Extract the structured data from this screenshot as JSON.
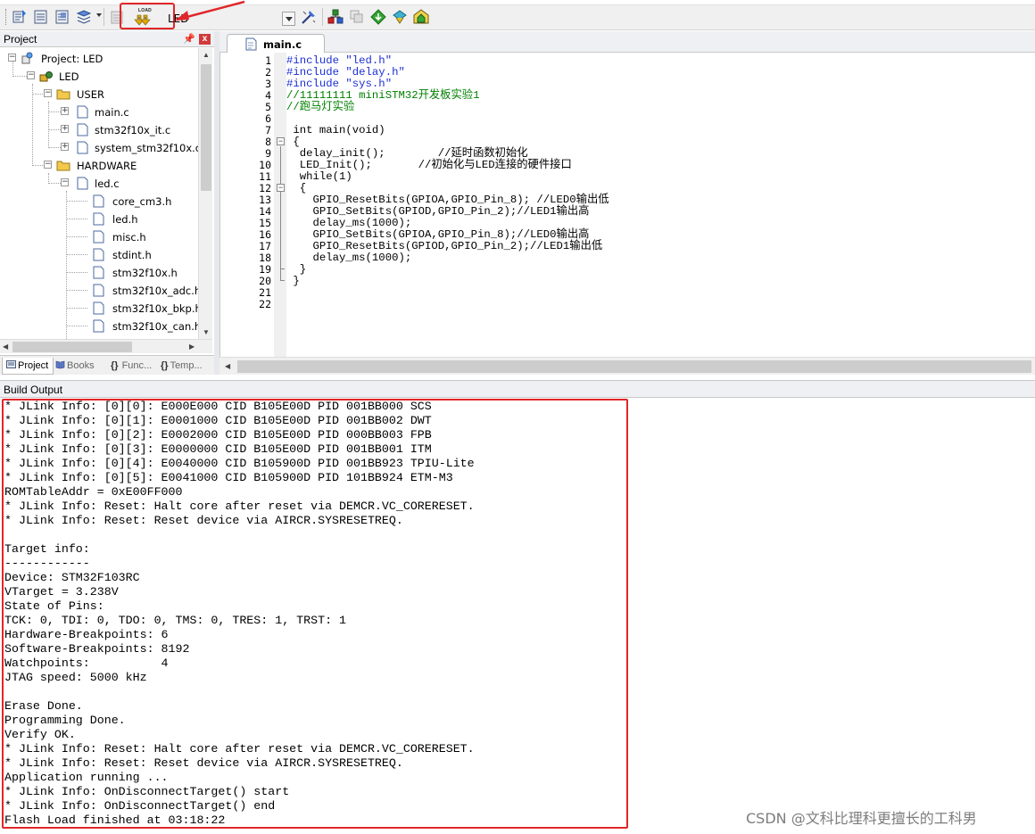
{
  "toolbar": {
    "load_label": "LOAD",
    "target": "LED"
  },
  "project_panel": {
    "title": "Project",
    "tree": [
      {
        "label": "Project: LED"
      },
      {
        "label": "LED"
      },
      {
        "label": "USER"
      },
      {
        "label": "main.c"
      },
      {
        "label": "stm32f10x_it.c"
      },
      {
        "label": "system_stm32f10x.c"
      },
      {
        "label": "HARDWARE"
      },
      {
        "label": "led.c"
      },
      {
        "label": "core_cm3.h"
      },
      {
        "label": "led.h"
      },
      {
        "label": "misc.h"
      },
      {
        "label": "stdint.h"
      },
      {
        "label": "stm32f10x.h"
      },
      {
        "label": "stm32f10x_adc.h"
      },
      {
        "label": "stm32f10x_bkp.h"
      },
      {
        "label": "stm32f10x_can.h"
      }
    ],
    "tabs": [
      "Project",
      "Books",
      "Func...",
      "Temp..."
    ]
  },
  "editor": {
    "tab": "main.c",
    "lines": [
      {
        "n": "1",
        "t": "#include \"led.h\""
      },
      {
        "n": "2",
        "t": "#include \"delay.h\""
      },
      {
        "n": "3",
        "t": "#include \"sys.h\""
      },
      {
        "n": "4",
        "t": "//11111111 miniSTM32开发板实验1"
      },
      {
        "n": "5",
        "t": "//跑马灯实验"
      },
      {
        "n": "6",
        "t": ""
      },
      {
        "n": "7",
        "t": " int main(void)"
      },
      {
        "n": "8",
        "t": " {"
      },
      {
        "n": "9",
        "t": "  delay_init();        //延时函数初始化"
      },
      {
        "n": "10",
        "t": "  LED_Init();       //初始化与LED连接的硬件接口"
      },
      {
        "n": "11",
        "t": "  while(1)"
      },
      {
        "n": "12",
        "t": "  {"
      },
      {
        "n": "13",
        "t": "    GPIO_ResetBits(GPIOA,GPIO_Pin_8); //LED0输出低"
      },
      {
        "n": "14",
        "t": "    GPIO_SetBits(GPIOD,GPIO_Pin_2);//LED1输出高"
      },
      {
        "n": "15",
        "t": "    delay_ms(1000);"
      },
      {
        "n": "16",
        "t": "    GPIO_SetBits(GPIOA,GPIO_Pin_8);//LED0输出高"
      },
      {
        "n": "17",
        "t": "    GPIO_ResetBits(GPIOD,GPIO_Pin_2);//LED1输出低"
      },
      {
        "n": "18",
        "t": "    delay_ms(1000);"
      },
      {
        "n": "19",
        "t": "  }"
      },
      {
        "n": "20",
        "t": " }"
      },
      {
        "n": "21",
        "t": ""
      },
      {
        "n": "22",
        "t": ""
      }
    ]
  },
  "build_output": {
    "title": "Build Output",
    "lines": [
      "* JLink Info: [0][0]: E000E000 CID B105E00D PID 001BB000 SCS",
      "* JLink Info: [0][1]: E0001000 CID B105E00D PID 001BB002 DWT",
      "* JLink Info: [0][2]: E0002000 CID B105E00D PID 000BB003 FPB",
      "* JLink Info: [0][3]: E0000000 CID B105E00D PID 001BB001 ITM",
      "* JLink Info: [0][4]: E0040000 CID B105900D PID 001BB923 TPIU-Lite",
      "* JLink Info: [0][5]: E0041000 CID B105900D PID 101BB924 ETM-M3",
      "ROMTableAddr = 0xE00FF000",
      "* JLink Info: Reset: Halt core after reset via DEMCR.VC_CORERESET.",
      "* JLink Info: Reset: Reset device via AIRCR.SYSRESETREQ.",
      "",
      "Target info:",
      "------------",
      "Device: STM32F103RC",
      "VTarget = 3.238V",
      "State of Pins:",
      "TCK: 0, TDI: 0, TDO: 0, TMS: 0, TRES: 1, TRST: 1",
      "Hardware-Breakpoints: 6",
      "Software-Breakpoints: 8192",
      "Watchpoints:          4",
      "JTAG speed: 5000 kHz",
      "",
      "Erase Done.",
      "Programming Done.",
      "Verify OK.",
      "* JLink Info: Reset: Halt core after reset via DEMCR.VC_CORERESET.",
      "* JLink Info: Reset: Reset device via AIRCR.SYSRESETREQ.",
      "Application running ...",
      "* JLink Info: OnDisconnectTarget() start",
      "* JLink Info: OnDisconnectTarget() end",
      "Flash Load finished at 03:18:22"
    ]
  },
  "watermark": "CSDN @文科比理科更擅长的工科男",
  "colors": {
    "highlight_red": "#e0262a",
    "comment_green": "#008000",
    "keyword_blue": "#1c2fd6",
    "string_magenta": "#b21c6f"
  }
}
